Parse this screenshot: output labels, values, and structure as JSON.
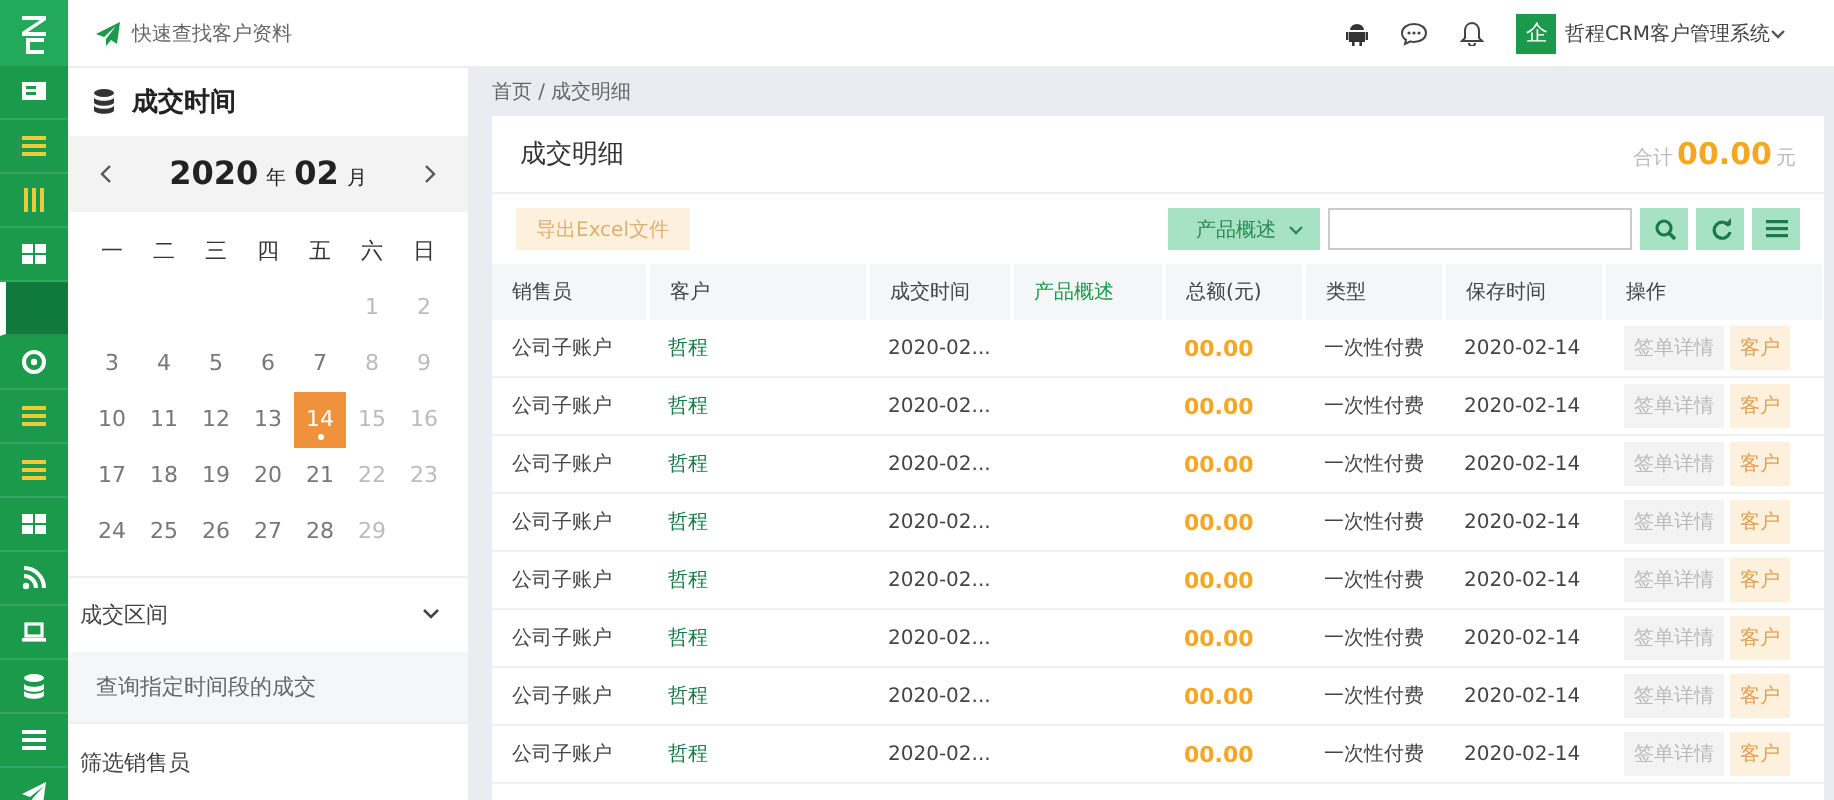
{
  "rail": {
    "items": [
      {
        "kind": "card",
        "highlighted": false,
        "selected": false
      },
      {
        "kind": "menu",
        "highlighted": true,
        "selected": false
      },
      {
        "kind": "columns",
        "highlighted": true,
        "selected": false
      },
      {
        "kind": "grid",
        "highlighted": false,
        "selected": false
      },
      {
        "kind": "blank",
        "highlighted": false,
        "selected": true
      },
      {
        "kind": "target",
        "highlighted": false,
        "selected": false
      },
      {
        "kind": "menu",
        "highlighted": true,
        "selected": false
      },
      {
        "kind": "menu",
        "highlighted": true,
        "selected": false
      },
      {
        "kind": "grid",
        "highlighted": false,
        "selected": false
      },
      {
        "kind": "rss",
        "highlighted": false,
        "selected": false
      },
      {
        "kind": "laptop",
        "highlighted": false,
        "selected": false
      },
      {
        "kind": "database",
        "highlighted": false,
        "selected": false
      },
      {
        "kind": "menu",
        "highlighted": false,
        "selected": false
      },
      {
        "kind": "send",
        "highlighted": false,
        "selected": false
      }
    ]
  },
  "topbar": {
    "quick_search": "快速查找客户资料",
    "company_badge": "企",
    "company_name": "哲程CRM客户管理系统"
  },
  "side_panel": {
    "title": "成交时间",
    "calendar": {
      "year": "2020",
      "year_unit": "年",
      "month": "02",
      "month_unit": "月",
      "weekdays": [
        "一",
        "二",
        "三",
        "四",
        "五",
        "六",
        "日"
      ],
      "weeks": [
        [
          {
            "day": "1",
            "muted": true,
            "selected": false,
            "marked": false
          },
          {
            "day": "2",
            "muted": true,
            "selected": false,
            "marked": false
          }
        ],
        [
          {
            "day": "3",
            "muted": false,
            "selected": false,
            "marked": false
          },
          {
            "day": "4",
            "muted": false,
            "selected": false,
            "marked": false
          },
          {
            "day": "5",
            "muted": false,
            "selected": false,
            "marked": false
          },
          {
            "day": "6",
            "muted": false,
            "selected": false,
            "marked": false
          },
          {
            "day": "7",
            "muted": false,
            "selected": false,
            "marked": false
          },
          {
            "day": "8",
            "muted": true,
            "selected": false,
            "marked": false
          },
          {
            "day": "9",
            "muted": true,
            "selected": false,
            "marked": false
          }
        ],
        [
          {
            "day": "10",
            "muted": false,
            "selected": false,
            "marked": false
          },
          {
            "day": "11",
            "muted": false,
            "selected": false,
            "marked": false
          },
          {
            "day": "12",
            "muted": false,
            "selected": false,
            "marked": false
          },
          {
            "day": "13",
            "muted": false,
            "selected": false,
            "marked": false
          },
          {
            "day": "14",
            "muted": false,
            "selected": true,
            "marked": true
          },
          {
            "day": "15",
            "muted": true,
            "selected": false,
            "marked": false
          },
          {
            "day": "16",
            "muted": true,
            "selected": false,
            "marked": false
          }
        ],
        [
          {
            "day": "17",
            "muted": false,
            "selected": false,
            "marked": false
          },
          {
            "day": "18",
            "muted": false,
            "selected": false,
            "marked": false
          },
          {
            "day": "19",
            "muted": false,
            "selected": false,
            "marked": false
          },
          {
            "day": "20",
            "muted": false,
            "selected": false,
            "marked": false
          },
          {
            "day": "21",
            "muted": false,
            "selected": false,
            "marked": false
          },
          {
            "day": "22",
            "muted": true,
            "selected": false,
            "marked": false
          },
          {
            "day": "23",
            "muted": true,
            "selected": false,
            "marked": false
          }
        ],
        [
          {
            "day": "24",
            "muted": false,
            "selected": false,
            "marked": false
          },
          {
            "day": "25",
            "muted": false,
            "selected": false,
            "marked": false
          },
          {
            "day": "26",
            "muted": false,
            "selected": false,
            "marked": false
          },
          {
            "day": "27",
            "muted": false,
            "selected": false,
            "marked": false
          },
          {
            "day": "28",
            "muted": false,
            "selected": false,
            "marked": false
          },
          {
            "day": "29",
            "muted": true,
            "selected": false,
            "marked": false
          }
        ]
      ]
    },
    "sections": [
      {
        "title": "成交区间",
        "expanded": true,
        "hint": "查询指定时间段的成交"
      },
      {
        "title": "筛选销售员",
        "expanded": false
      }
    ]
  },
  "main": {
    "breadcrumb": "首页 / 成交明细",
    "card": {
      "title": "成交明细",
      "total_label": "合计",
      "total_value": "00.00",
      "total_unit": "元",
      "export_button": "导出Excel文件",
      "filter_dropdown": "产品概述",
      "table": {
        "columns": [
          {
            "label": "销售员",
            "link": false
          },
          {
            "label": "客户",
            "link": false
          },
          {
            "label": "成交时间",
            "link": false
          },
          {
            "label": "产品概述",
            "link": true
          },
          {
            "label": "总额(元)",
            "link": false
          },
          {
            "label": "类型",
            "link": false
          },
          {
            "label": "保存时间",
            "link": false
          },
          {
            "label": "操作",
            "link": false
          }
        ],
        "rows": [
          {
            "salesperson": "公司子账户",
            "customer": "哲程",
            "deal_time": "2020-02...",
            "amount": "00.00",
            "type": "一次性付费",
            "saved_time": "2020-02-14",
            "actions": [
              "签单详情",
              "客户"
            ]
          },
          {
            "salesperson": "公司子账户",
            "customer": "哲程",
            "deal_time": "2020-02...",
            "amount": "00.00",
            "type": "一次性付费",
            "saved_time": "2020-02-14",
            "actions": [
              "签单详情",
              "客户"
            ]
          },
          {
            "salesperson": "公司子账户",
            "customer": "哲程",
            "deal_time": "2020-02...",
            "amount": "00.00",
            "type": "一次性付费",
            "saved_time": "2020-02-14",
            "actions": [
              "签单详情",
              "客户"
            ]
          },
          {
            "salesperson": "公司子账户",
            "customer": "哲程",
            "deal_time": "2020-02...",
            "amount": "00.00",
            "type": "一次性付费",
            "saved_time": "2020-02-14",
            "actions": [
              "签单详情",
              "客户"
            ]
          },
          {
            "salesperson": "公司子账户",
            "customer": "哲程",
            "deal_time": "2020-02...",
            "amount": "00.00",
            "type": "一次性付费",
            "saved_time": "2020-02-14",
            "actions": [
              "签单详情",
              "客户"
            ]
          },
          {
            "salesperson": "公司子账户",
            "customer": "哲程",
            "deal_time": "2020-02...",
            "amount": "00.00",
            "type": "一次性付费",
            "saved_time": "2020-02-14",
            "actions": [
              "签单详情",
              "客户"
            ]
          },
          {
            "salesperson": "公司子账户",
            "customer": "哲程",
            "deal_time": "2020-02...",
            "amount": "00.00",
            "type": "一次性付费",
            "saved_time": "2020-02-14",
            "actions": [
              "签单详情",
              "客户"
            ]
          },
          {
            "salesperson": "公司子账户",
            "customer": "哲程",
            "deal_time": "2020-02...",
            "amount": "00.00",
            "type": "一次性付费",
            "saved_time": "2020-02-14",
            "actions": [
              "签单详情",
              "客户"
            ]
          }
        ]
      }
    }
  }
}
